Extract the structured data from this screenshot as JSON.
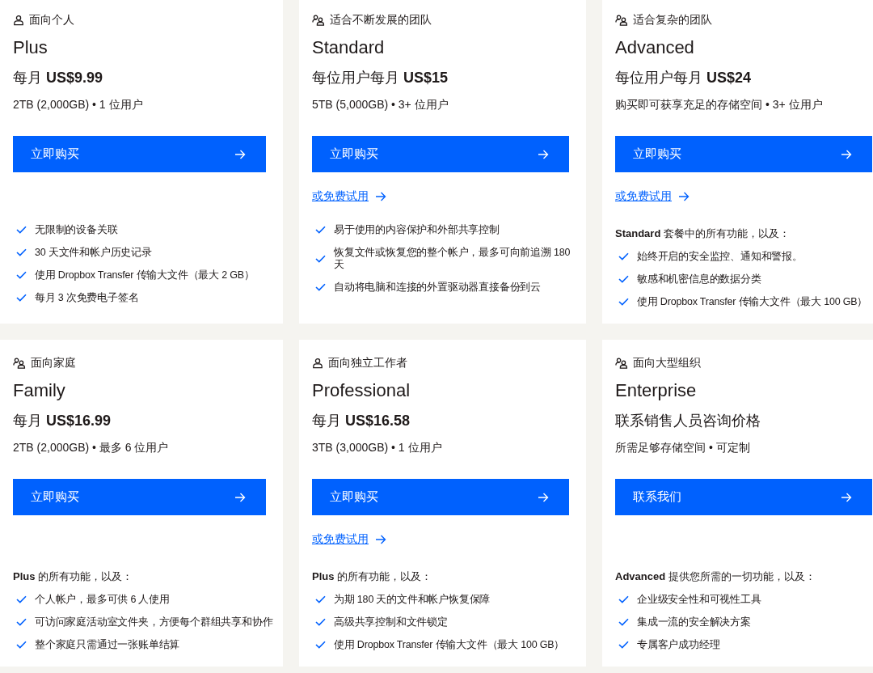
{
  "plans": [
    {
      "kind": "single",
      "audience": "面向个人",
      "name": "Plus",
      "price": "每月 **US$9.99**",
      "storage": "2TB (2,000GB) • 1 位用户",
      "button": "立即购买",
      "features": [
        "无限制的设备关联",
        "30 天文件和帐户历史记录",
        "使用 Dropbox Transfer 传输大文件（最大 2 GB）",
        "每月 3 次免费电子签名"
      ]
    },
    {
      "kind": "group",
      "audience": "适合不断发展的团队",
      "name": "Standard",
      "price": "每位用户每月 **US$15**",
      "storage": "5TB (5,000GB) • 3+ 位用户",
      "button": "立即购买",
      "trial": "或免费试用",
      "features": [
        "易于使用的内容保护和外部共享控制",
        "恢复文件或恢复您的整个帐户，最多可向前追溯 180 天",
        "自动将电脑和连接的外置驱动器直接备份到云"
      ]
    },
    {
      "kind": "group",
      "audience": "适合复杂的团队",
      "name": "Advanced",
      "price": "每位用户每月 **US$24**",
      "storage": "购买即可获享充足的存储空间 • 3+ 位用户",
      "button": "立即购买",
      "trial": "或免费试用",
      "features_intro": "**Standard** 套餐中的所有功能，以及：",
      "features": [
        "始终开启的安全监控、通知和警报。",
        "敏感和机密信息的数据分类",
        "使用 Dropbox Transfer 传输大文件（最大 100 GB）"
      ]
    },
    {
      "kind": "group",
      "audience": "面向家庭",
      "name": "Family",
      "price": "每月 **US$16.99**",
      "storage": "2TB (2,000GB) • 最多 6 位用户",
      "button": "立即购买",
      "features_intro": "**Plus** 的所有功能，以及：",
      "features": [
        "个人帐户，最多可供 6 人使用",
        "可访问家庭活动室文件夹，方便每个群组共享和协作",
        "整个家庭只需通过一张账单结算"
      ]
    },
    {
      "kind": "single",
      "audience": "面向独立工作者",
      "name": "Professional",
      "price": "每月 **US$16.58**",
      "storage": "3TB (3,000GB) • 1 位用户",
      "button": "立即购买",
      "trial": "或免费试用",
      "features_intro": "**Plus** 的所有功能，以及：",
      "features": [
        "为期 180 天的文件和帐户恢复保障",
        "高级共享控制和文件锁定",
        "使用 Dropbox Transfer 传输大文件（最大 100 GB）"
      ]
    },
    {
      "kind": "group",
      "audience": "面向大型组织",
      "name": "Enterprise",
      "price": "联系销售人员咨询价格",
      "storage": "所需足够存储空间 • 可定制",
      "button": "联系我们",
      "features_intro": "**Advanced** 提供您所需的一切功能，以及：",
      "features": [
        "企业级安全性和可视性工具",
        "集成一流的安全解决方案",
        "专属客户成功经理"
      ]
    }
  ]
}
